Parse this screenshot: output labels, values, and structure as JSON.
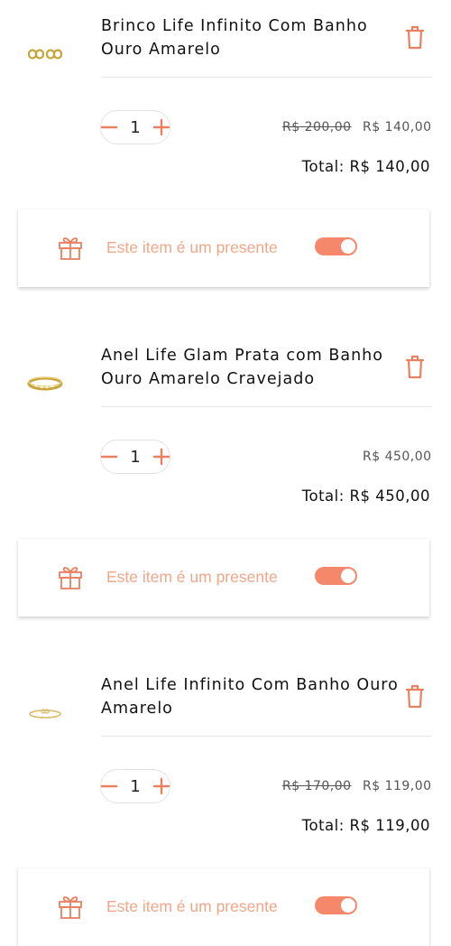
{
  "colors": {
    "accent": "#e9805f",
    "toggle_on": "#f5876a",
    "gift_text": "#f0a688"
  },
  "items": [
    {
      "name": "Brinco Life Infinito Com Banho Ouro Amarelo",
      "quantity": "1",
      "old_price": "R$ 200,00",
      "price": "R$ 140,00",
      "total": "Total: R$ 140,00",
      "gift_label": "Este item é um presente",
      "gift_enabled": true
    },
    {
      "name": "Anel Life Glam Prata com Banho Ouro Amarelo Cravejado",
      "quantity": "1",
      "old_price": "",
      "price": "R$ 450,00",
      "total": "Total: R$ 450,00",
      "gift_label": "Este item é um presente",
      "gift_enabled": true
    },
    {
      "name": "Anel Life Infinito Com Banho Ouro Amarelo",
      "quantity": "1",
      "old_price": "R$ 170,00",
      "price": "R$ 119,00",
      "total": "Total: R$ 119,00",
      "gift_label": "Este item é um presente",
      "gift_enabled": true
    }
  ]
}
